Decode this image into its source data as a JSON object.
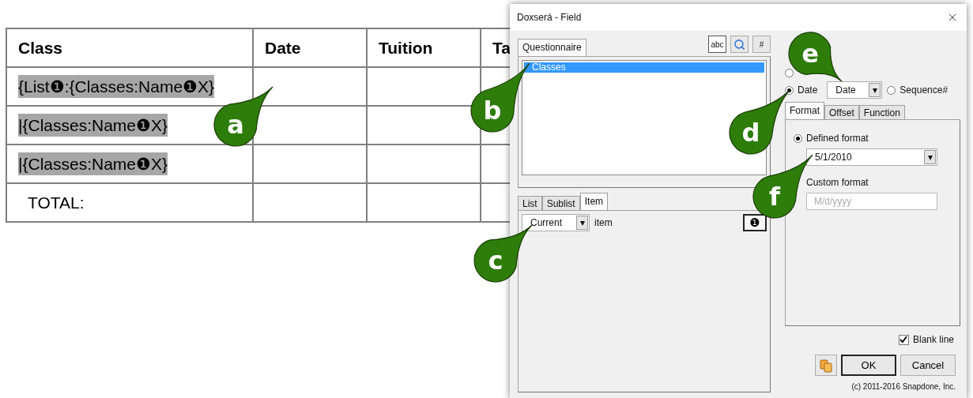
{
  "document_table": {
    "columns": [
      "Class",
      "Date",
      "Tuition",
      "Ta"
    ],
    "rows": [
      {
        "class": "{List❶:{Classes:Name❶X}",
        "highlighted": true
      },
      {
        "class": "|{Classes:Name❶X}",
        "highlighted": true
      },
      {
        "class": "|{Classes:Name❶X}",
        "highlighted": true
      },
      {
        "class": "TOTAL:",
        "highlighted": false
      }
    ]
  },
  "dialog": {
    "title": "Doxserá - Field",
    "questionnaire_tab": "Questionnaire",
    "toolbar": [
      {
        "kind": "text",
        "label": "abc",
        "selected": true
      },
      {
        "kind": "search",
        "selected": false
      },
      {
        "kind": "text",
        "label": "#",
        "selected": false
      }
    ],
    "list_items": [
      {
        "label": "Classes",
        "selected": true
      }
    ],
    "lower_tabs": [
      {
        "label": "List",
        "selected": false
      },
      {
        "label": "Sublist",
        "selected": false
      },
      {
        "label": "Item",
        "selected": true
      }
    ],
    "item_select": {
      "value": "Current",
      "caret": "▾"
    },
    "item_label": "item",
    "item_button": "❶",
    "type_options": [
      {
        "selected": false
      },
      {
        "label": "Date",
        "selected": true
      },
      {
        "label": "Sequence#",
        "selected": false
      }
    ],
    "date_select": {
      "value": "Date",
      "caret": "▾"
    },
    "format_tabs": [
      {
        "label": "Format",
        "selected": true
      },
      {
        "label": "Offset",
        "selected": false
      },
      {
        "label": "Function",
        "selected": false
      }
    ],
    "format_options": [
      {
        "kind": "select",
        "label": "Defined format",
        "selected": true,
        "value": "5/1/2010",
        "caret": "▾"
      },
      {
        "kind": "text",
        "label": "Custom format",
        "placeholder": "M/d/yyyy"
      }
    ],
    "blank_line": {
      "label": "Blank line",
      "checked": true
    },
    "buttons": [
      {
        "kind": "icon"
      },
      {
        "kind": "text",
        "label": "OK",
        "default": true
      },
      {
        "kind": "text",
        "label": "Cancel",
        "default": false
      }
    ],
    "copyright": "(c) 2011-2016 Snapdone, Inc."
  },
  "callouts": [
    {
      "letter": "a"
    },
    {
      "letter": "b"
    },
    {
      "letter": "c"
    },
    {
      "letter": "d"
    },
    {
      "letter": "e"
    },
    {
      "letter": "f"
    }
  ]
}
